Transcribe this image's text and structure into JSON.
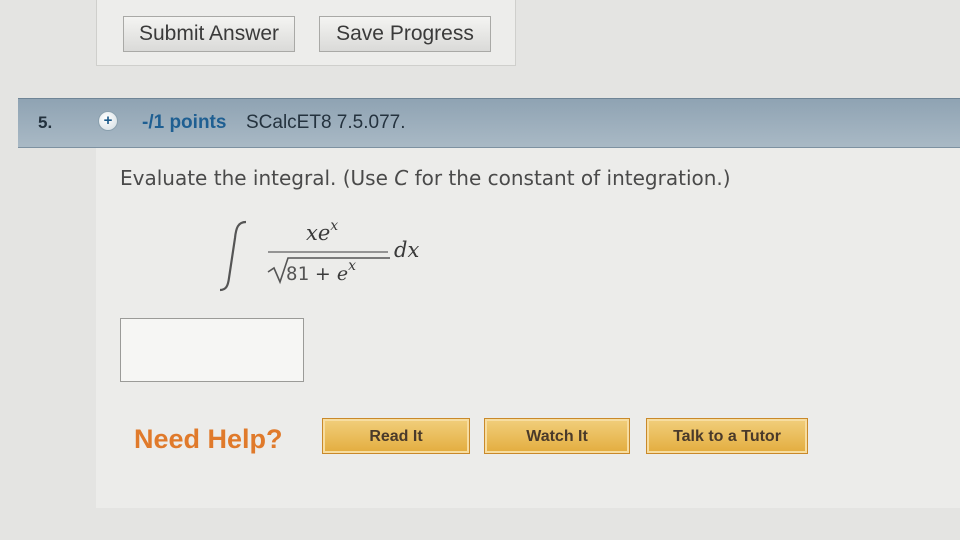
{
  "top_actions": {
    "submit_label": "Submit Answer",
    "save_label": "Save Progress"
  },
  "question": {
    "number": "5.",
    "points": "-/1 points",
    "code": "SCalcET8 7.5.077.",
    "prompt_before": "Evaluate the integral. (Use ",
    "prompt_var": "C",
    "prompt_after": " for the constant of integration.)",
    "integral": {
      "numerator_base": "xe",
      "numerator_exp": "x",
      "denominator_const": "81",
      "denominator_op": " + ",
      "denominator_base": "e",
      "denominator_exp": "x",
      "differential": "dx"
    },
    "answer_value": ""
  },
  "help": {
    "label": "Need Help?",
    "read_label": "Read It",
    "watch_label": "Watch It",
    "tutor_label": "Talk to a Tutor"
  },
  "colors": {
    "header_bg": "#9fb1bf",
    "points_text": "#1f5f92",
    "help_text": "#e07a2b",
    "help_button": "#e9bb55"
  },
  "icons": {
    "expand": "plus-circle-icon"
  }
}
